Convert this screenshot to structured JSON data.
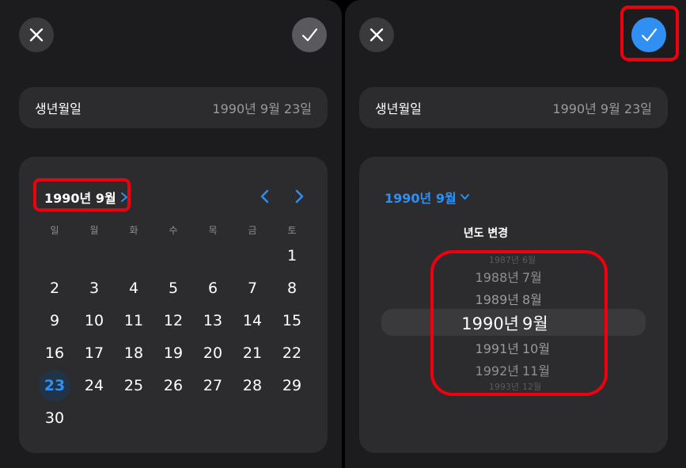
{
  "colors": {
    "accent": "#2f8ff2",
    "highlight": "#f0000f"
  },
  "icons": {
    "close": "close-icon",
    "confirm": "checkmark-icon",
    "chevron_right": "chevron-right-icon",
    "chevron_left": "chevron-left-icon",
    "chevron_down": "chevron-down-icon"
  },
  "left": {
    "field": {
      "label": "생년월일",
      "value": "1990년 9월 23일"
    },
    "calendar": {
      "month_title": "1990년 9월",
      "weekdays": [
        "일",
        "월",
        "화",
        "수",
        "목",
        "금",
        "토"
      ],
      "days": [
        "1",
        "2",
        "3",
        "4",
        "5",
        "6",
        "7",
        "8",
        "9",
        "10",
        "11",
        "12",
        "13",
        "14",
        "15",
        "16",
        "17",
        "18",
        "19",
        "20",
        "21",
        "22",
        "23",
        "24",
        "25",
        "26",
        "27",
        "28",
        "29",
        "30"
      ],
      "first_weekday_index": 6,
      "selected_day": "23"
    }
  },
  "right": {
    "field": {
      "label": "생년월일",
      "value": "1990년 9월 23일"
    },
    "month_title": "1990년 9월",
    "picker_label": "년도 변경",
    "years": [
      "1987년",
      "1988년",
      "1989년",
      "1990년",
      "1991년",
      "1992년",
      "1993년"
    ],
    "months": [
      "6월",
      "7월",
      "8월",
      "9월",
      "10월",
      "11월",
      "12월"
    ],
    "selected_index": 3
  }
}
